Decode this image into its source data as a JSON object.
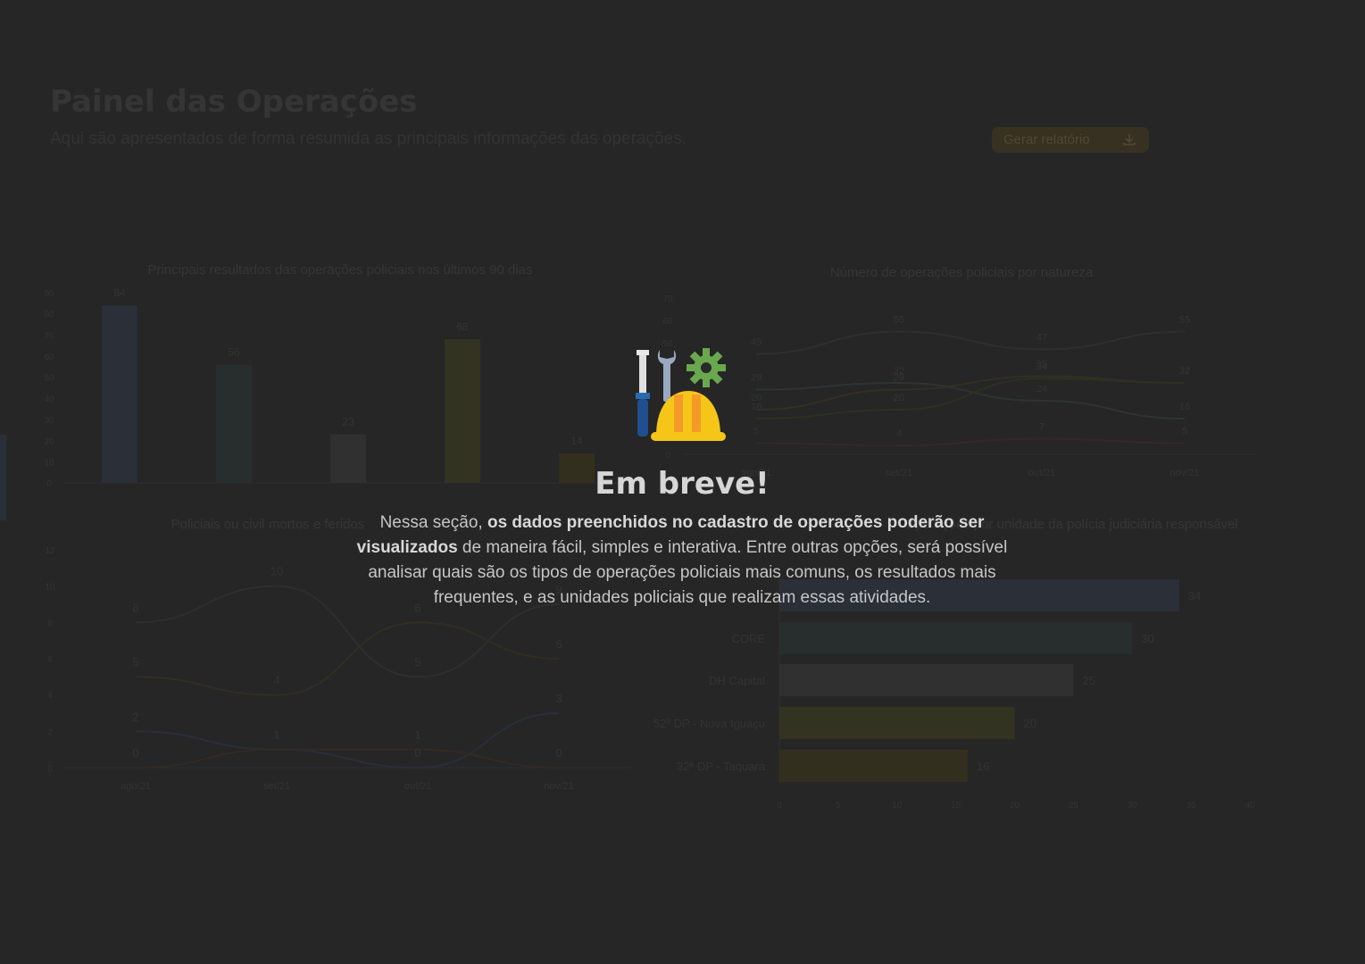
{
  "dashboard": {
    "title": "Painel das Operações",
    "subtitle": "Aqui são apresentados de forma resumida as principais informações das operações.",
    "report_button": "Gerar relatório",
    "report_icon": "download-icon"
  },
  "chart_data": [
    {
      "type": "bar",
      "title": "Principais resultados das operações policiais nos últimos 90 dias",
      "categories": [
        "",
        "",
        "",
        "",
        ""
      ],
      "values": [
        84,
        56,
        23,
        68,
        14
      ],
      "ylim": [
        0,
        90
      ],
      "yticks": [
        0,
        10,
        20,
        30,
        40,
        50,
        60,
        70,
        80,
        90
      ],
      "colors": [
        "#2f3540",
        "#2d3432",
        "#363636",
        "#3a3a24",
        "#3a3520"
      ]
    },
    {
      "type": "line",
      "title": "Número de operações policiais por natureza",
      "categories": [
        "ago/21",
        "set/21",
        "out/21",
        "nov/21"
      ],
      "ylim": [
        0,
        70
      ],
      "yticks": [
        0,
        50,
        60,
        70
      ],
      "series": [
        {
          "values": [
            45,
            55,
            47,
            55
          ],
          "color": "#343434"
        },
        {
          "values": [
            29,
            32,
            24,
            16
          ],
          "color": "#343a3a"
        },
        {
          "values": [
            20,
            29,
            35,
            32
          ],
          "color": "#3a3528"
        },
        {
          "values": [
            16,
            20,
            34,
            32
          ],
          "color": "#353524"
        },
        {
          "values": [
            5,
            4,
            7,
            5
          ],
          "color": "#3c2a30"
        }
      ],
      "labels": [
        {
          "i": 0,
          "v": "45"
        },
        {
          "i": 1,
          "v": "55"
        },
        {
          "i": 2,
          "v": "47"
        },
        {
          "i": 3,
          "v": "55"
        },
        {
          "i": 0,
          "v": "29"
        },
        {
          "i": 1,
          "v": "32"
        },
        {
          "i": 2,
          "v": "34"
        },
        {
          "i": 3,
          "v": "32"
        },
        {
          "i": 1,
          "v": "29"
        },
        {
          "i": 2,
          "v": "35"
        },
        {
          "i": 3,
          "v": "16"
        }
      ]
    },
    {
      "type": "line",
      "title": "Policiais ou civil mortos e feridos",
      "categories": [
        "ago/21",
        "set/21",
        "out/21",
        "nov/21"
      ],
      "ylim": [
        0,
        12
      ],
      "yticks": [
        0,
        2,
        4,
        6,
        8,
        10,
        12
      ],
      "series": [
        {
          "values": [
            8,
            10,
            5,
            9
          ],
          "color": "#343434"
        },
        {
          "values": [
            5,
            4,
            8,
            6
          ],
          "color": "#363424"
        },
        {
          "values": [
            2,
            1,
            0,
            3
          ],
          "color": "#2c3442"
        },
        {
          "values": [
            0,
            1,
            1,
            0
          ],
          "color": "#3a2e24"
        }
      ],
      "labels": [
        {
          "i": 0,
          "v": "8"
        },
        {
          "i": 1,
          "v": "10"
        },
        {
          "i": 2,
          "v": "5"
        },
        {
          "i": 3,
          "v": "6"
        },
        {
          "i": 0,
          "v": "5"
        },
        {
          "i": 1,
          "v": "4"
        },
        {
          "i": 0,
          "v": "2"
        },
        {
          "i": 1,
          "v": "1"
        },
        {
          "i": 2,
          "v": "1"
        },
        {
          "i": 3,
          "v": "3"
        },
        {
          "i": 0,
          "v": "0"
        },
        {
          "i": 3,
          "v": "0"
        }
      ]
    },
    {
      "type": "bar",
      "orientation": "horizontal",
      "title": "Operações por unidade da polícia judiciária responsável",
      "categories": [
        "",
        "CORE",
        "DH Capital",
        "52ª DP - Nova Iguaçu",
        "32ª DP - Taquara"
      ],
      "values": [
        34,
        30,
        25,
        20,
        16
      ],
      "xlim": [
        0,
        40
      ],
      "xticks": [
        0,
        5,
        10,
        15,
        20,
        25,
        30,
        35,
        40
      ],
      "colors": [
        "#2f3540",
        "#2d3432",
        "#363636",
        "#3a3a24",
        "#3a3520"
      ]
    }
  ],
  "modal": {
    "icon": "tools-construction-icon",
    "title": "Em breve!",
    "body_start": "Nessa seção, ",
    "body_bold": "os dados preenchidos no cadastro de operações poderão ser visualizados",
    "body_end": " de maneira fácil, simples e interativa. Entre outras opções, será possível analisar quais são os tipos de operações policiais mais comuns, os resultados mais frequentes, e as unidades policiais que realizam essas atividades."
  }
}
